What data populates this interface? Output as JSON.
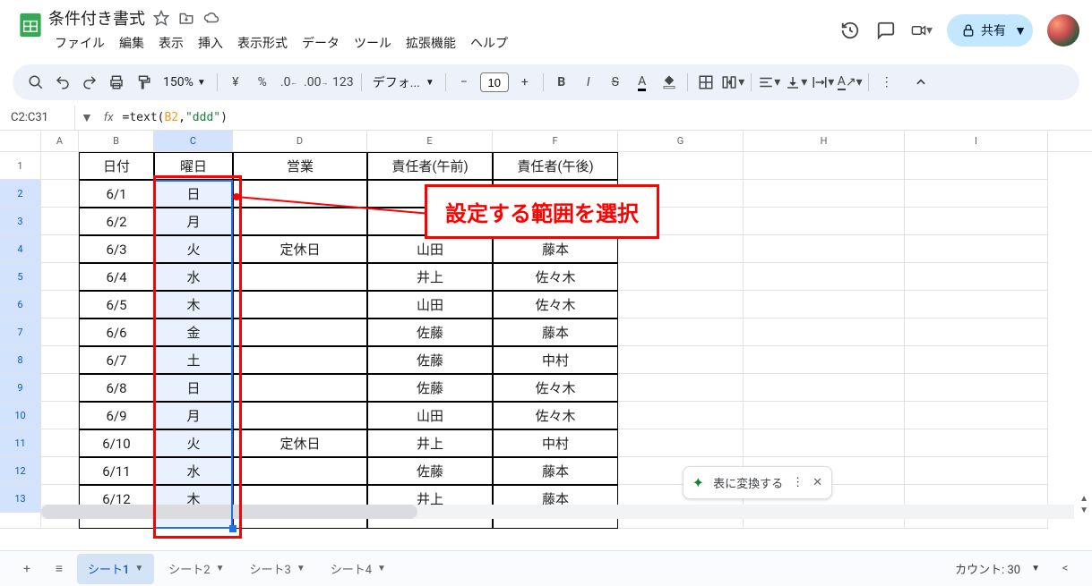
{
  "doc": {
    "title": "条件付き書式"
  },
  "menus": [
    "ファイル",
    "編集",
    "表示",
    "挿入",
    "表示形式",
    "データ",
    "ツール",
    "拡張機能",
    "ヘルプ"
  ],
  "share": {
    "label": "共有"
  },
  "toolbar": {
    "zoom": "150%",
    "font": "デフォ...",
    "fontsize": "10"
  },
  "formula_bar": {
    "range": "C2:C31",
    "fx": "fx",
    "formula_prefix": "=text(",
    "formula_ref": "B2",
    "formula_mid": ",",
    "formula_str": "\"ddd\"",
    "formula_suffix": ")"
  },
  "columns": [
    "A",
    "B",
    "C",
    "D",
    "E",
    "F",
    "G",
    "H",
    "I"
  ],
  "row_labels": [
    "1",
    "2",
    "3",
    "4",
    "5",
    "6",
    "7",
    "8",
    "9",
    "10",
    "11",
    "12",
    "13"
  ],
  "headers": {
    "B": "日付",
    "C": "曜日",
    "D": "営業",
    "E": "責任者(午前)",
    "F": "責任者(午後)"
  },
  "rows": [
    {
      "B": "6/1",
      "C": "日",
      "D": "",
      "E": "",
      "F": ""
    },
    {
      "B": "6/2",
      "C": "月",
      "D": "",
      "E": "",
      "F": ""
    },
    {
      "B": "6/3",
      "C": "火",
      "D": "定休日",
      "E": "山田",
      "F": "藤本"
    },
    {
      "B": "6/4",
      "C": "水",
      "D": "",
      "E": "井上",
      "F": "佐々木"
    },
    {
      "B": "6/5",
      "C": "木",
      "D": "",
      "E": "山田",
      "F": "佐々木"
    },
    {
      "B": "6/6",
      "C": "金",
      "D": "",
      "E": "佐藤",
      "F": "藤本"
    },
    {
      "B": "6/7",
      "C": "土",
      "D": "",
      "E": "佐藤",
      "F": "中村"
    },
    {
      "B": "6/8",
      "C": "日",
      "D": "",
      "E": "佐藤",
      "F": "佐々木"
    },
    {
      "B": "6/9",
      "C": "月",
      "D": "",
      "E": "山田",
      "F": "佐々木"
    },
    {
      "B": "6/10",
      "C": "火",
      "D": "定休日",
      "E": "井上",
      "F": "中村"
    },
    {
      "B": "6/11",
      "C": "水",
      "D": "",
      "E": "佐藤",
      "F": "藤本"
    },
    {
      "B": "6/12",
      "C": "木",
      "D": "",
      "E": "井上",
      "F": "藤本"
    }
  ],
  "annotation": {
    "text": "設定する範囲を選択"
  },
  "chip": {
    "label": "表に変換する"
  },
  "sheets": [
    {
      "name": "シート1",
      "active": true
    },
    {
      "name": "シート2",
      "active": false
    },
    {
      "name": "シート3",
      "active": false
    },
    {
      "name": "シート4",
      "active": false
    }
  ],
  "status": {
    "count_label": "カウント: 30"
  }
}
